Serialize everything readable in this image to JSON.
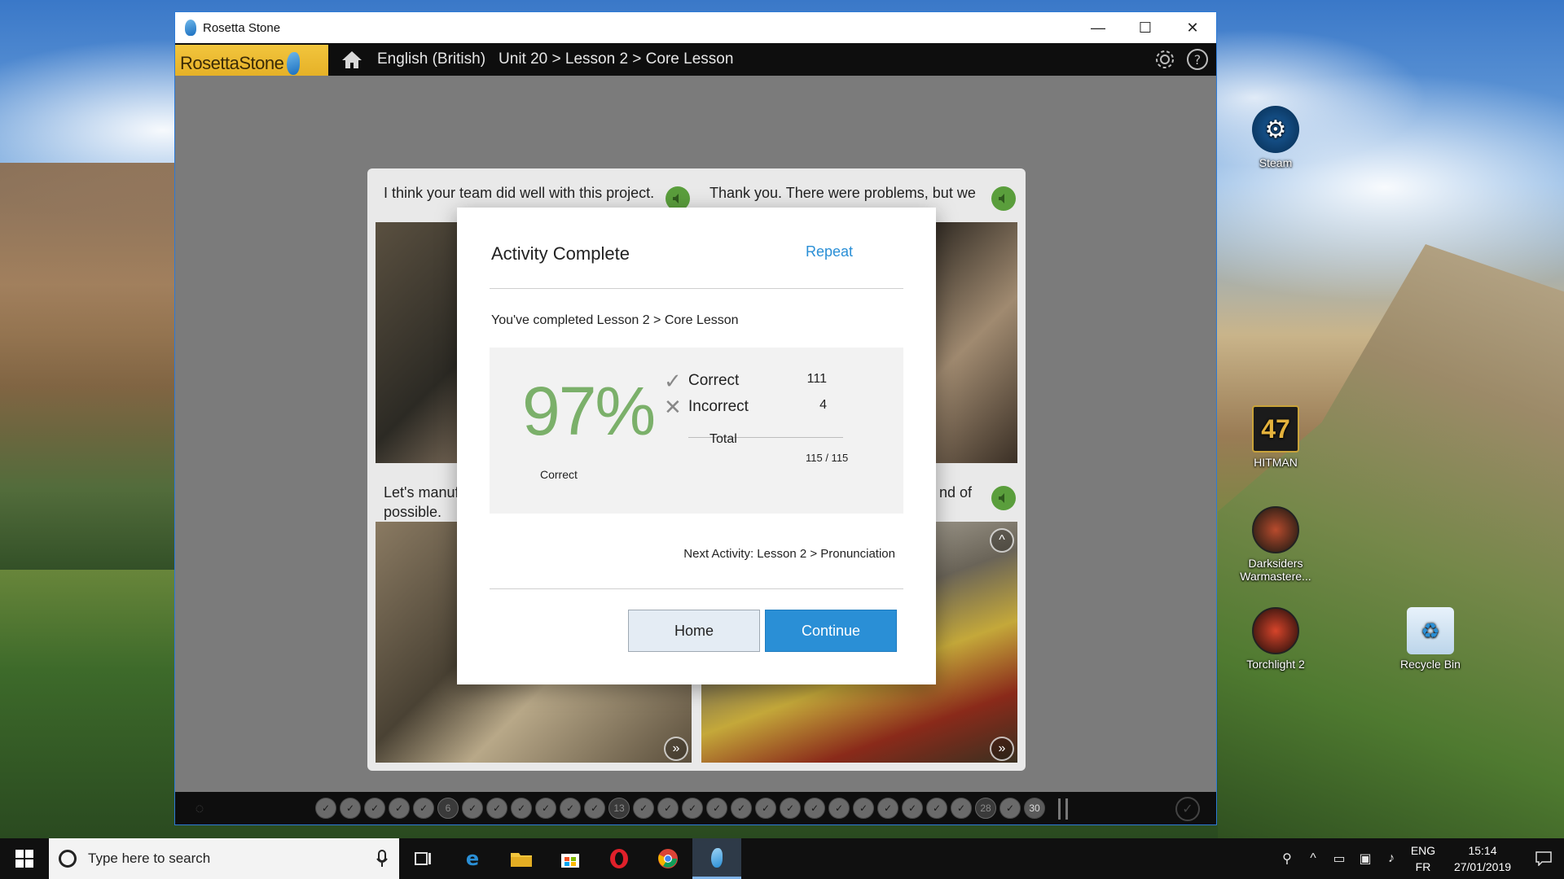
{
  "window": {
    "title": "Rosetta Stone",
    "controls": {
      "minimize": "—",
      "maximize": "☐",
      "close": "✕"
    }
  },
  "appbar": {
    "brand": "RosettaStone",
    "language": "English (British)",
    "breadcrumb": "Unit 20 > Lesson 2 > Core Lesson"
  },
  "cards": [
    {
      "caption": "I think your team did well with this project."
    },
    {
      "caption": "Thank you. There were problems, but we"
    },
    {
      "caption": "Let's manuf",
      "caption2": "possible."
    },
    {
      "caption": "nd of"
    }
  ],
  "modal": {
    "title": "Activity Complete",
    "repeat": "Repeat",
    "completed": "You've completed Lesson 2 > Core Lesson",
    "percent": "97%",
    "percent_label": "Correct",
    "correct_label": "Correct",
    "correct_value": "111",
    "incorrect_label": "Incorrect",
    "incorrect_value": "4",
    "total_label": "Total",
    "total_value": "115 / 115",
    "next_activity": "Next Activity: Lesson 2 > Pronunciation",
    "home": "Home",
    "continue": "Continue"
  },
  "progress": {
    "dots": [
      "",
      "",
      "",
      "",
      "",
      "6",
      "",
      "",
      "",
      "",
      "",
      "",
      "13",
      "",
      "",
      "",
      "",
      "",
      "",
      "",
      "",
      "",
      "",
      "",
      "",
      "",
      "",
      "28",
      "",
      "30"
    ]
  },
  "desktop_icons": [
    {
      "label": "Steam"
    },
    {
      "label": "HITMAN",
      "glyph": "47"
    },
    {
      "label": "Darksiders Warmastere..."
    },
    {
      "label": "Torchlight 2"
    },
    {
      "label": "Recycle Bin"
    }
  ],
  "taskbar": {
    "search_placeholder": "Type here to search",
    "lang_top": "ENG",
    "lang_bottom": "FR",
    "time": "15:14",
    "date": "27/01/2019"
  },
  "colors": {
    "accent": "#2a8fd6",
    "score_green": "#7bb06a",
    "brand_yellow": "#f2c53d"
  }
}
